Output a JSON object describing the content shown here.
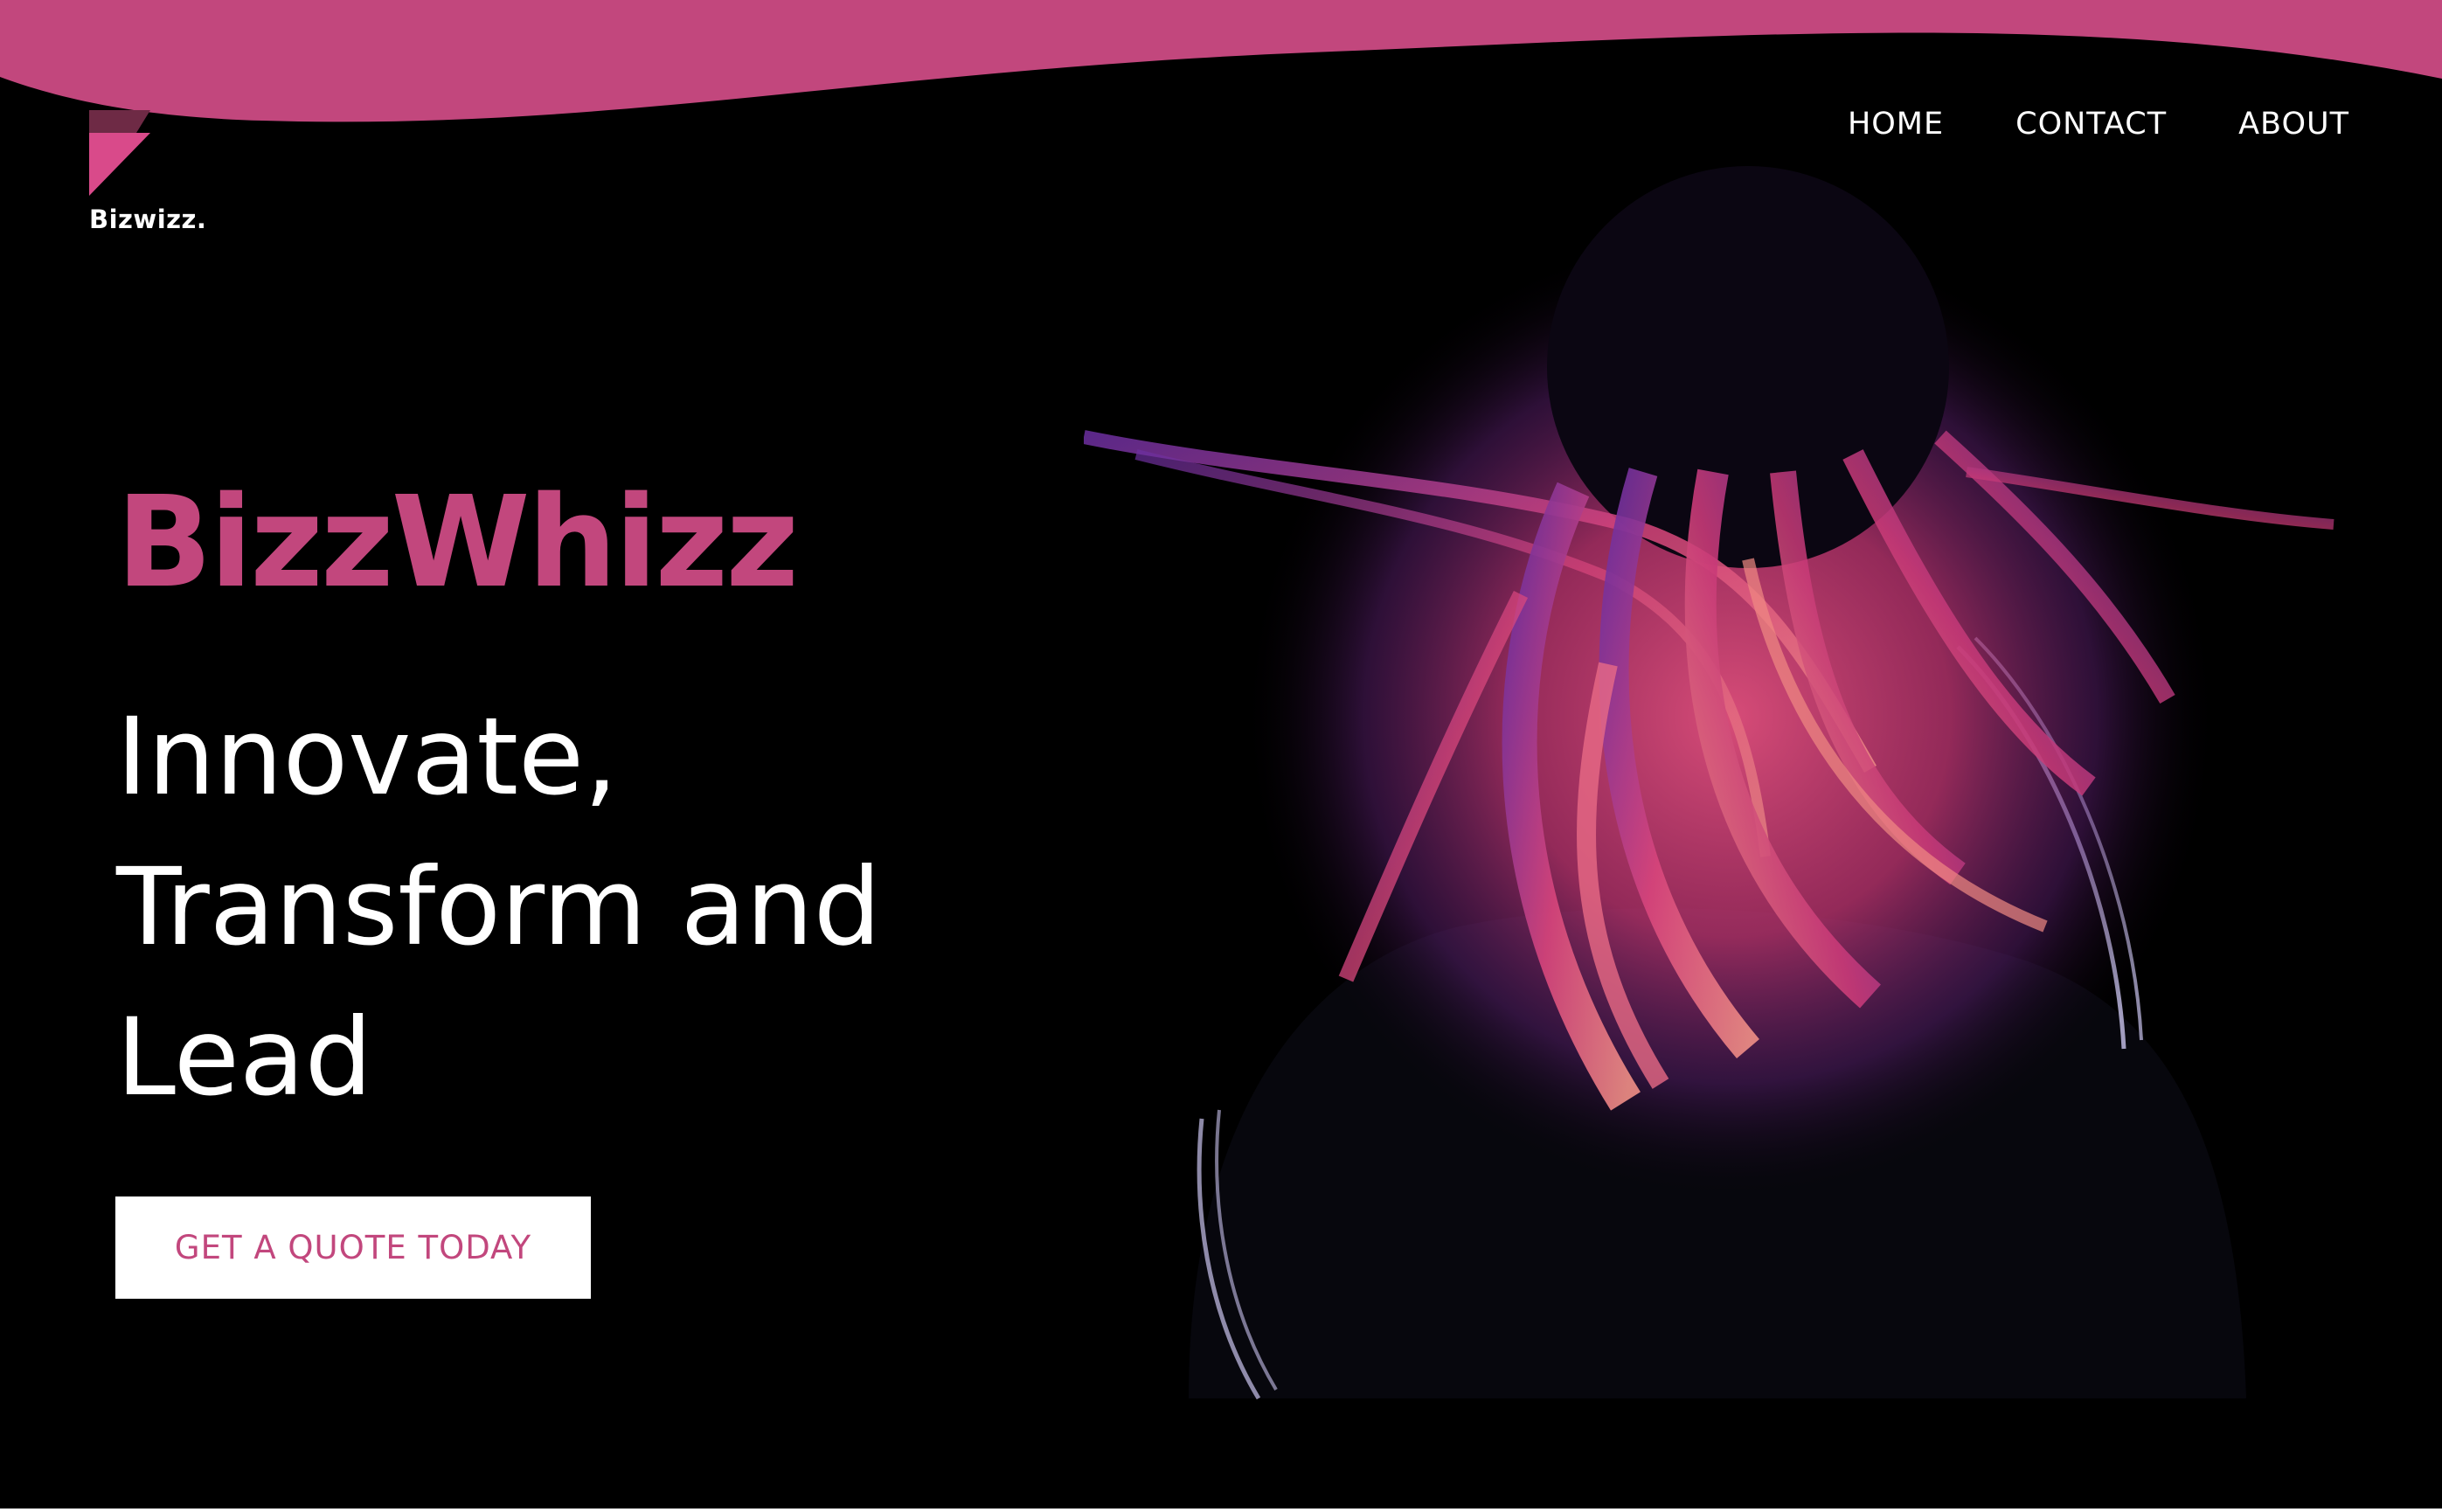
{
  "colors": {
    "accent": "#c2477d",
    "background": "#000000",
    "text": "#ffffff"
  },
  "logo": {
    "icon": "bizwizz-logo-mark",
    "text": "Bizwizz."
  },
  "nav": {
    "items": [
      {
        "label": "HOME"
      },
      {
        "label": "CONTACT"
      },
      {
        "label": "ABOUT"
      }
    ]
  },
  "hero": {
    "title": "BizzWhizz",
    "tagline": [
      "Innovate,",
      "Transform and",
      "Lead"
    ],
    "cta_label": "GET A QUOTE TODAY"
  }
}
